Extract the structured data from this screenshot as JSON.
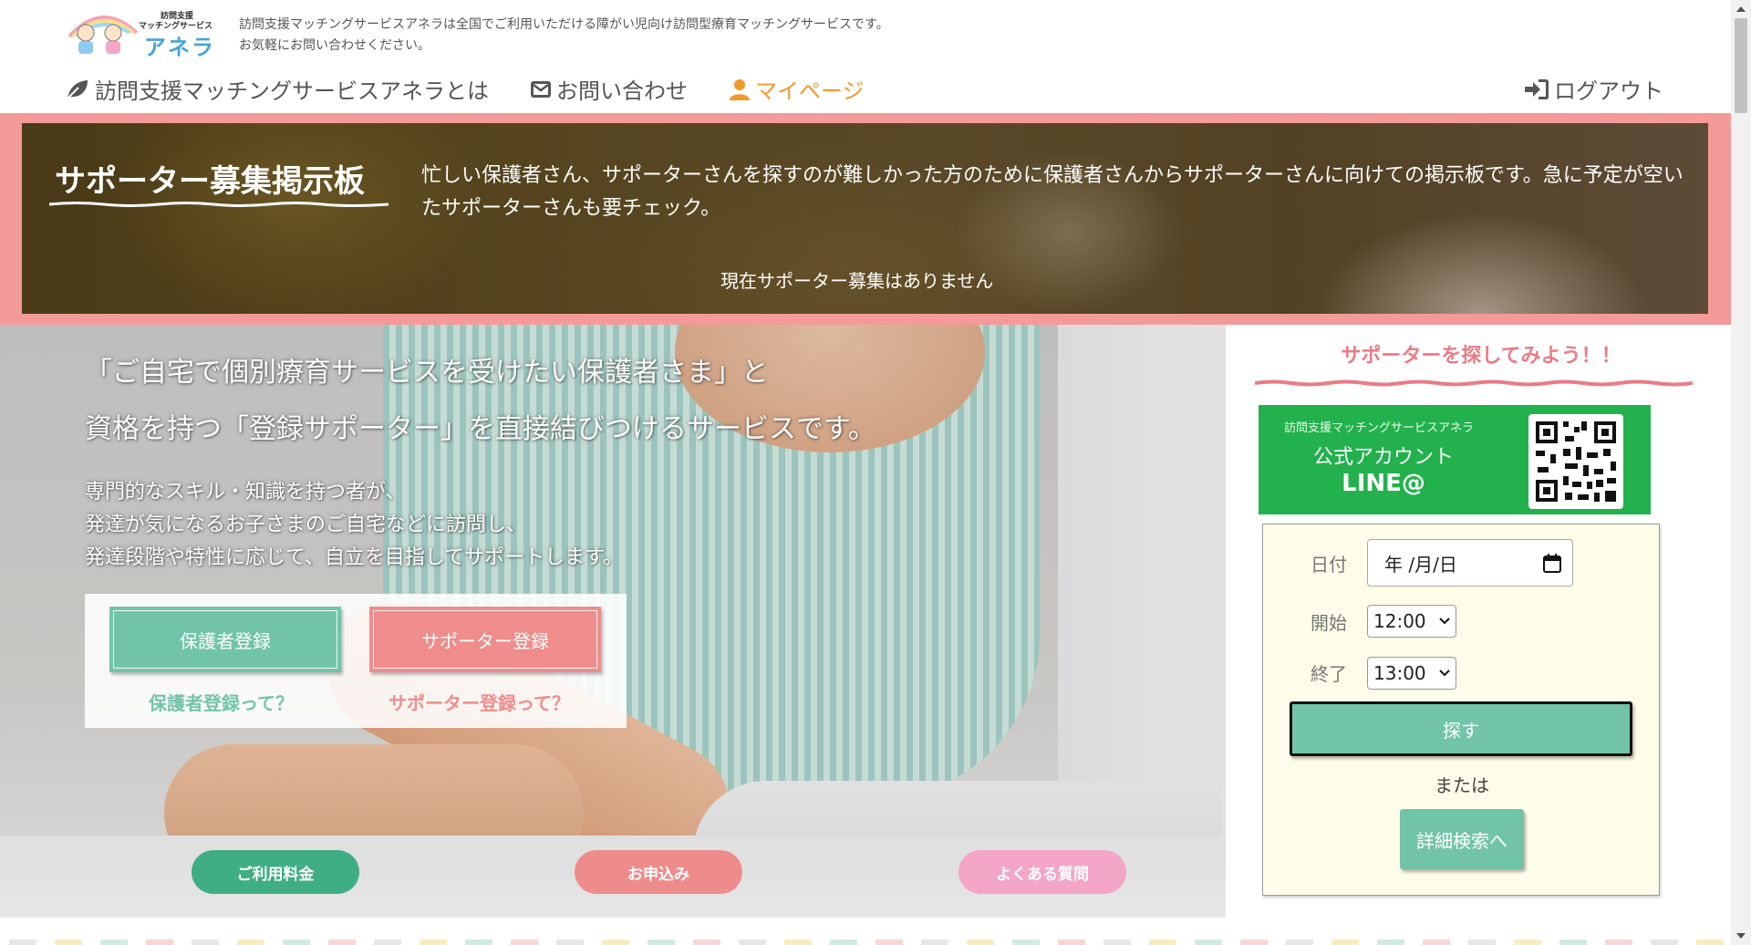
{
  "header": {
    "logo_line1": "訪問支援",
    "logo_line2": "マッチングサービス",
    "logo_name": "アネラ",
    "tagline_line1": "訪問支援マッチングサービスアネラは全国でご利用いただける障がい児向け訪問型療育マッチングサービスです。",
    "tagline_line2": "お気軽にお問い合わせください。"
  },
  "nav": {
    "about": "訪問支援マッチングサービスアネラとは",
    "contact": "お問い合わせ",
    "mypage": "マイページ",
    "logout": "ログアウト",
    "active_color": "#f19a2c"
  },
  "board": {
    "title": "サポーター募集掲示板",
    "description": "忙しい保護者さん、サポーターさんを探すのが難しかった方のために保護者さんからサポーターさんに向けての掲示板です。急に予定が空いたサポーターさんも要チェック。",
    "status": "現在サポーター募集はありません",
    "frame_color": "#f49a98"
  },
  "hero": {
    "headline_line1": "「ご自宅で個別療育サービスを受けたい保護者さま」と",
    "headline_line2": "資格を持つ「登録サポーター」を直接結びつけるサービスです。",
    "sub_line1": "専門的なスキル・知識を持つ者が、",
    "sub_line2": "発達が気になるお子さまのご自宅などに訪問し、",
    "sub_line3": "発達段階や特性に応じて、自立を目指してサポートします。",
    "parent_register": "保護者登録",
    "supporter_register": "サポーター登録",
    "parent_register_link": "保護者登録って？",
    "supporter_register_link": "サポーター登録って？",
    "fee": "ご利用料金",
    "apply": "お申込み",
    "faq": "よくある質問"
  },
  "side": {
    "title": "サポーターを探してみよう！！",
    "line_small": "訪問支援マッチングサービスアネラ",
    "line_account": "公式アカウント",
    "line_name": "LINE@",
    "date_label": "日付",
    "date_value": "年 /月/日",
    "start_label": "開始",
    "start_value": "12:00",
    "end_label": "終了",
    "end_value": "13:00",
    "search_button": "探す",
    "or_text": "または",
    "detail_button": "詳細検索へ",
    "accent_green": "#72c4a9",
    "accent_pink": "#ef8c8c"
  }
}
